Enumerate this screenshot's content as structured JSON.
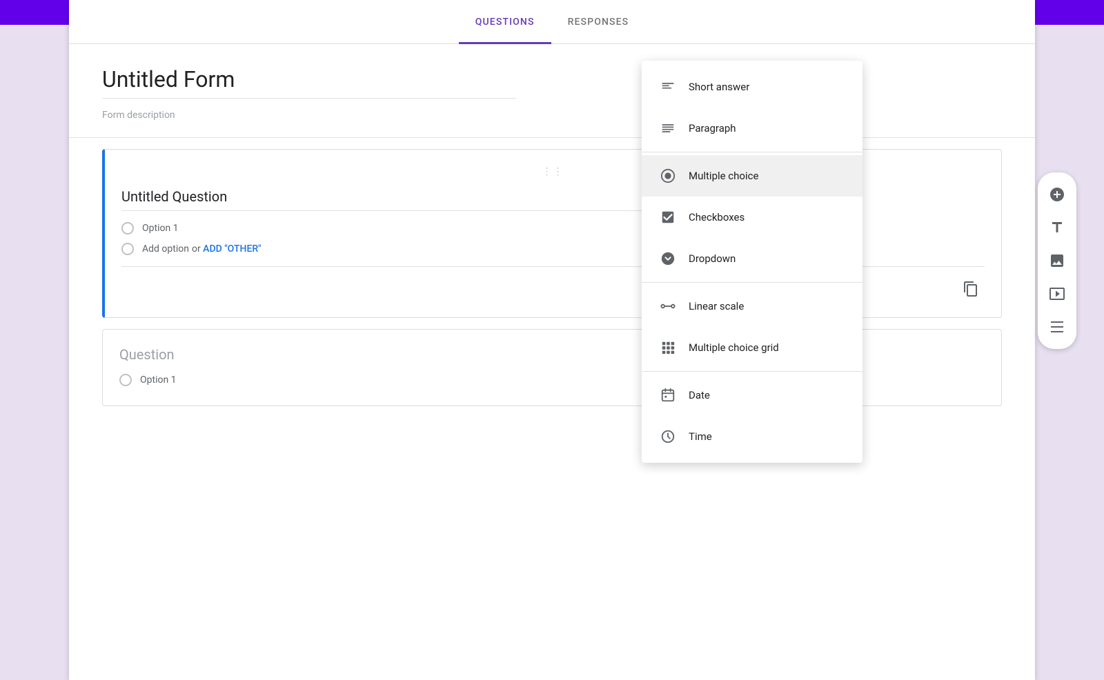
{
  "topBar": {
    "color": "#6200ea"
  },
  "tabs": {
    "questions": {
      "label": "QUESTIONS",
      "active": true
    },
    "responses": {
      "label": "RESPONSES",
      "active": false
    }
  },
  "formHeader": {
    "title": "Untitled Form",
    "description": "Form description"
  },
  "questionCard": {
    "title": "Untitled Question",
    "option1": "Option 1",
    "addOptionText": "Add option",
    "addOptionOr": "or",
    "addOtherLabel": "ADD \"OTHER\""
  },
  "questionCard2": {
    "title": "Question",
    "option1": "Option 1"
  },
  "dropdownMenu": {
    "items": [
      {
        "id": "short-answer",
        "label": "Short answer",
        "icon": "short-answer"
      },
      {
        "id": "paragraph",
        "label": "Paragraph",
        "icon": "paragraph"
      },
      {
        "id": "multiple-choice",
        "label": "Multiple choice",
        "icon": "multiple-choice",
        "selected": true
      },
      {
        "id": "checkboxes",
        "label": "Checkboxes",
        "icon": "checkboxes"
      },
      {
        "id": "dropdown",
        "label": "Dropdown",
        "icon": "dropdown"
      },
      {
        "id": "linear-scale",
        "label": "Linear scale",
        "icon": "linear-scale"
      },
      {
        "id": "multiple-choice-grid",
        "label": "Multiple choice grid",
        "icon": "multiple-choice-grid"
      },
      {
        "id": "date",
        "label": "Date",
        "icon": "date"
      },
      {
        "id": "time",
        "label": "Time",
        "icon": "time"
      }
    ]
  },
  "rightToolbar": {
    "buttons": [
      {
        "id": "add",
        "icon": "plus",
        "label": "Add question"
      },
      {
        "id": "text",
        "icon": "text",
        "label": "Add title and description"
      },
      {
        "id": "image",
        "icon": "image",
        "label": "Add image"
      },
      {
        "id": "video",
        "icon": "video",
        "label": "Add video"
      },
      {
        "id": "section",
        "icon": "section",
        "label": "Add section"
      }
    ]
  }
}
